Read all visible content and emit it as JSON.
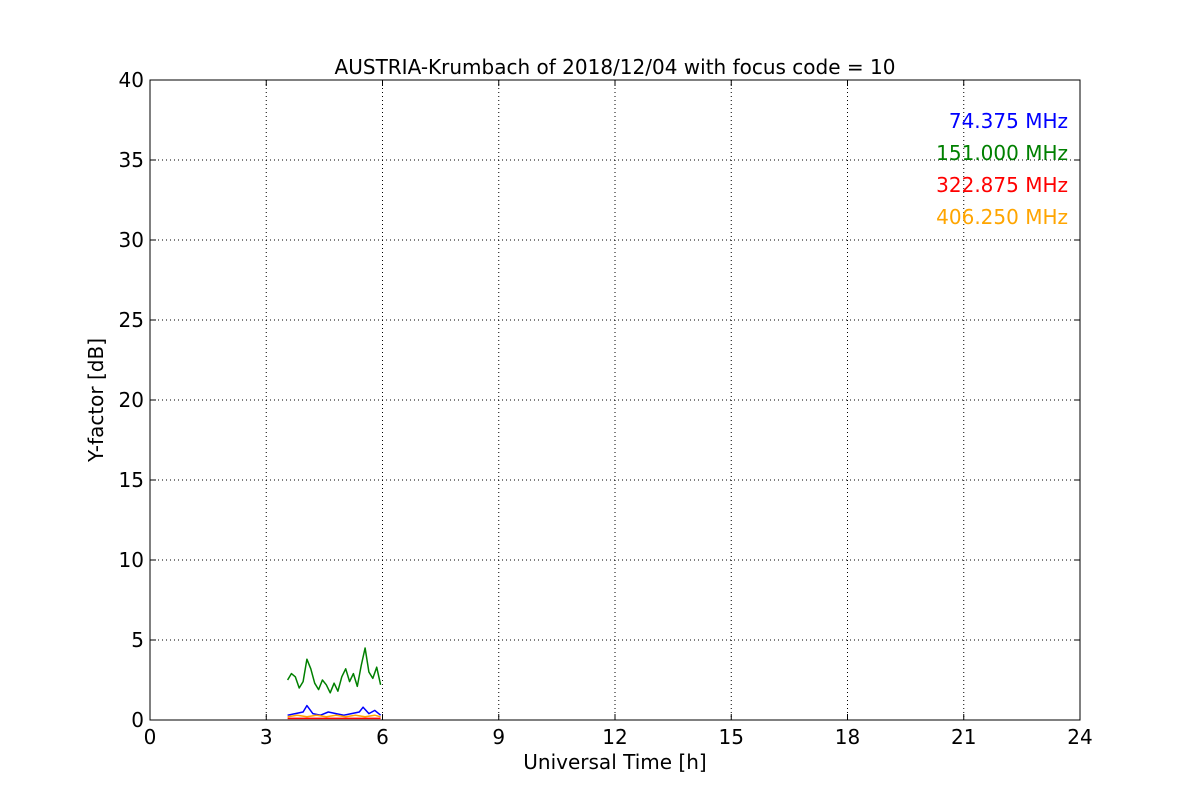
{
  "chart_data": {
    "type": "line",
    "title": "AUSTRIA-Krumbach of 2018/12/04 with focus code = 10",
    "xlabel": "Universal Time [h]",
    "ylabel": "Y-factor [dB]",
    "xlim": [
      0,
      24
    ],
    "ylim": [
      0,
      40
    ],
    "xticks": [
      0,
      3,
      6,
      9,
      12,
      15,
      18,
      21,
      24
    ],
    "yticks": [
      0,
      5,
      10,
      15,
      20,
      25,
      30,
      35,
      40
    ],
    "grid": true,
    "legend_position": "top-right",
    "series": [
      {
        "name": "74.375 MHz",
        "color": "#0000ff",
        "x": [
          3.55,
          3.75,
          3.95,
          4.05,
          4.2,
          4.4,
          4.6,
          4.8,
          5.0,
          5.2,
          5.4,
          5.5,
          5.65,
          5.8,
          5.95
        ],
        "y": [
          0.3,
          0.4,
          0.5,
          0.9,
          0.4,
          0.3,
          0.5,
          0.4,
          0.3,
          0.4,
          0.5,
          0.8,
          0.4,
          0.6,
          0.3
        ]
      },
      {
        "name": "151.000 MHz",
        "color": "#008000",
        "x": [
          3.55,
          3.65,
          3.75,
          3.85,
          3.95,
          4.05,
          4.15,
          4.25,
          4.35,
          4.45,
          4.55,
          4.65,
          4.75,
          4.85,
          4.95,
          5.05,
          5.15,
          5.25,
          5.35,
          5.45,
          5.55,
          5.65,
          5.75,
          5.85,
          5.95
        ],
        "y": [
          2.5,
          2.9,
          2.7,
          2.0,
          2.4,
          3.8,
          3.2,
          2.3,
          1.9,
          2.5,
          2.2,
          1.7,
          2.3,
          1.8,
          2.7,
          3.2,
          2.4,
          2.9,
          2.1,
          3.4,
          4.5,
          3.0,
          2.6,
          3.3,
          2.2
        ]
      },
      {
        "name": "322.875 MHz",
        "color": "#ff0000",
        "x": [
          3.55,
          4.0,
          4.5,
          5.0,
          5.5,
          5.95
        ],
        "y": [
          0.1,
          0.1,
          0.1,
          0.1,
          0.1,
          0.1
        ]
      },
      {
        "name": "406.250 MHz",
        "color": "#ffa500",
        "x": [
          3.55,
          3.8,
          4.05,
          4.3,
          4.55,
          4.8,
          5.05,
          5.3,
          5.55,
          5.8,
          5.95
        ],
        "y": [
          0.2,
          0.3,
          0.2,
          0.3,
          0.2,
          0.3,
          0.2,
          0.3,
          0.2,
          0.3,
          0.2
        ]
      }
    ]
  }
}
